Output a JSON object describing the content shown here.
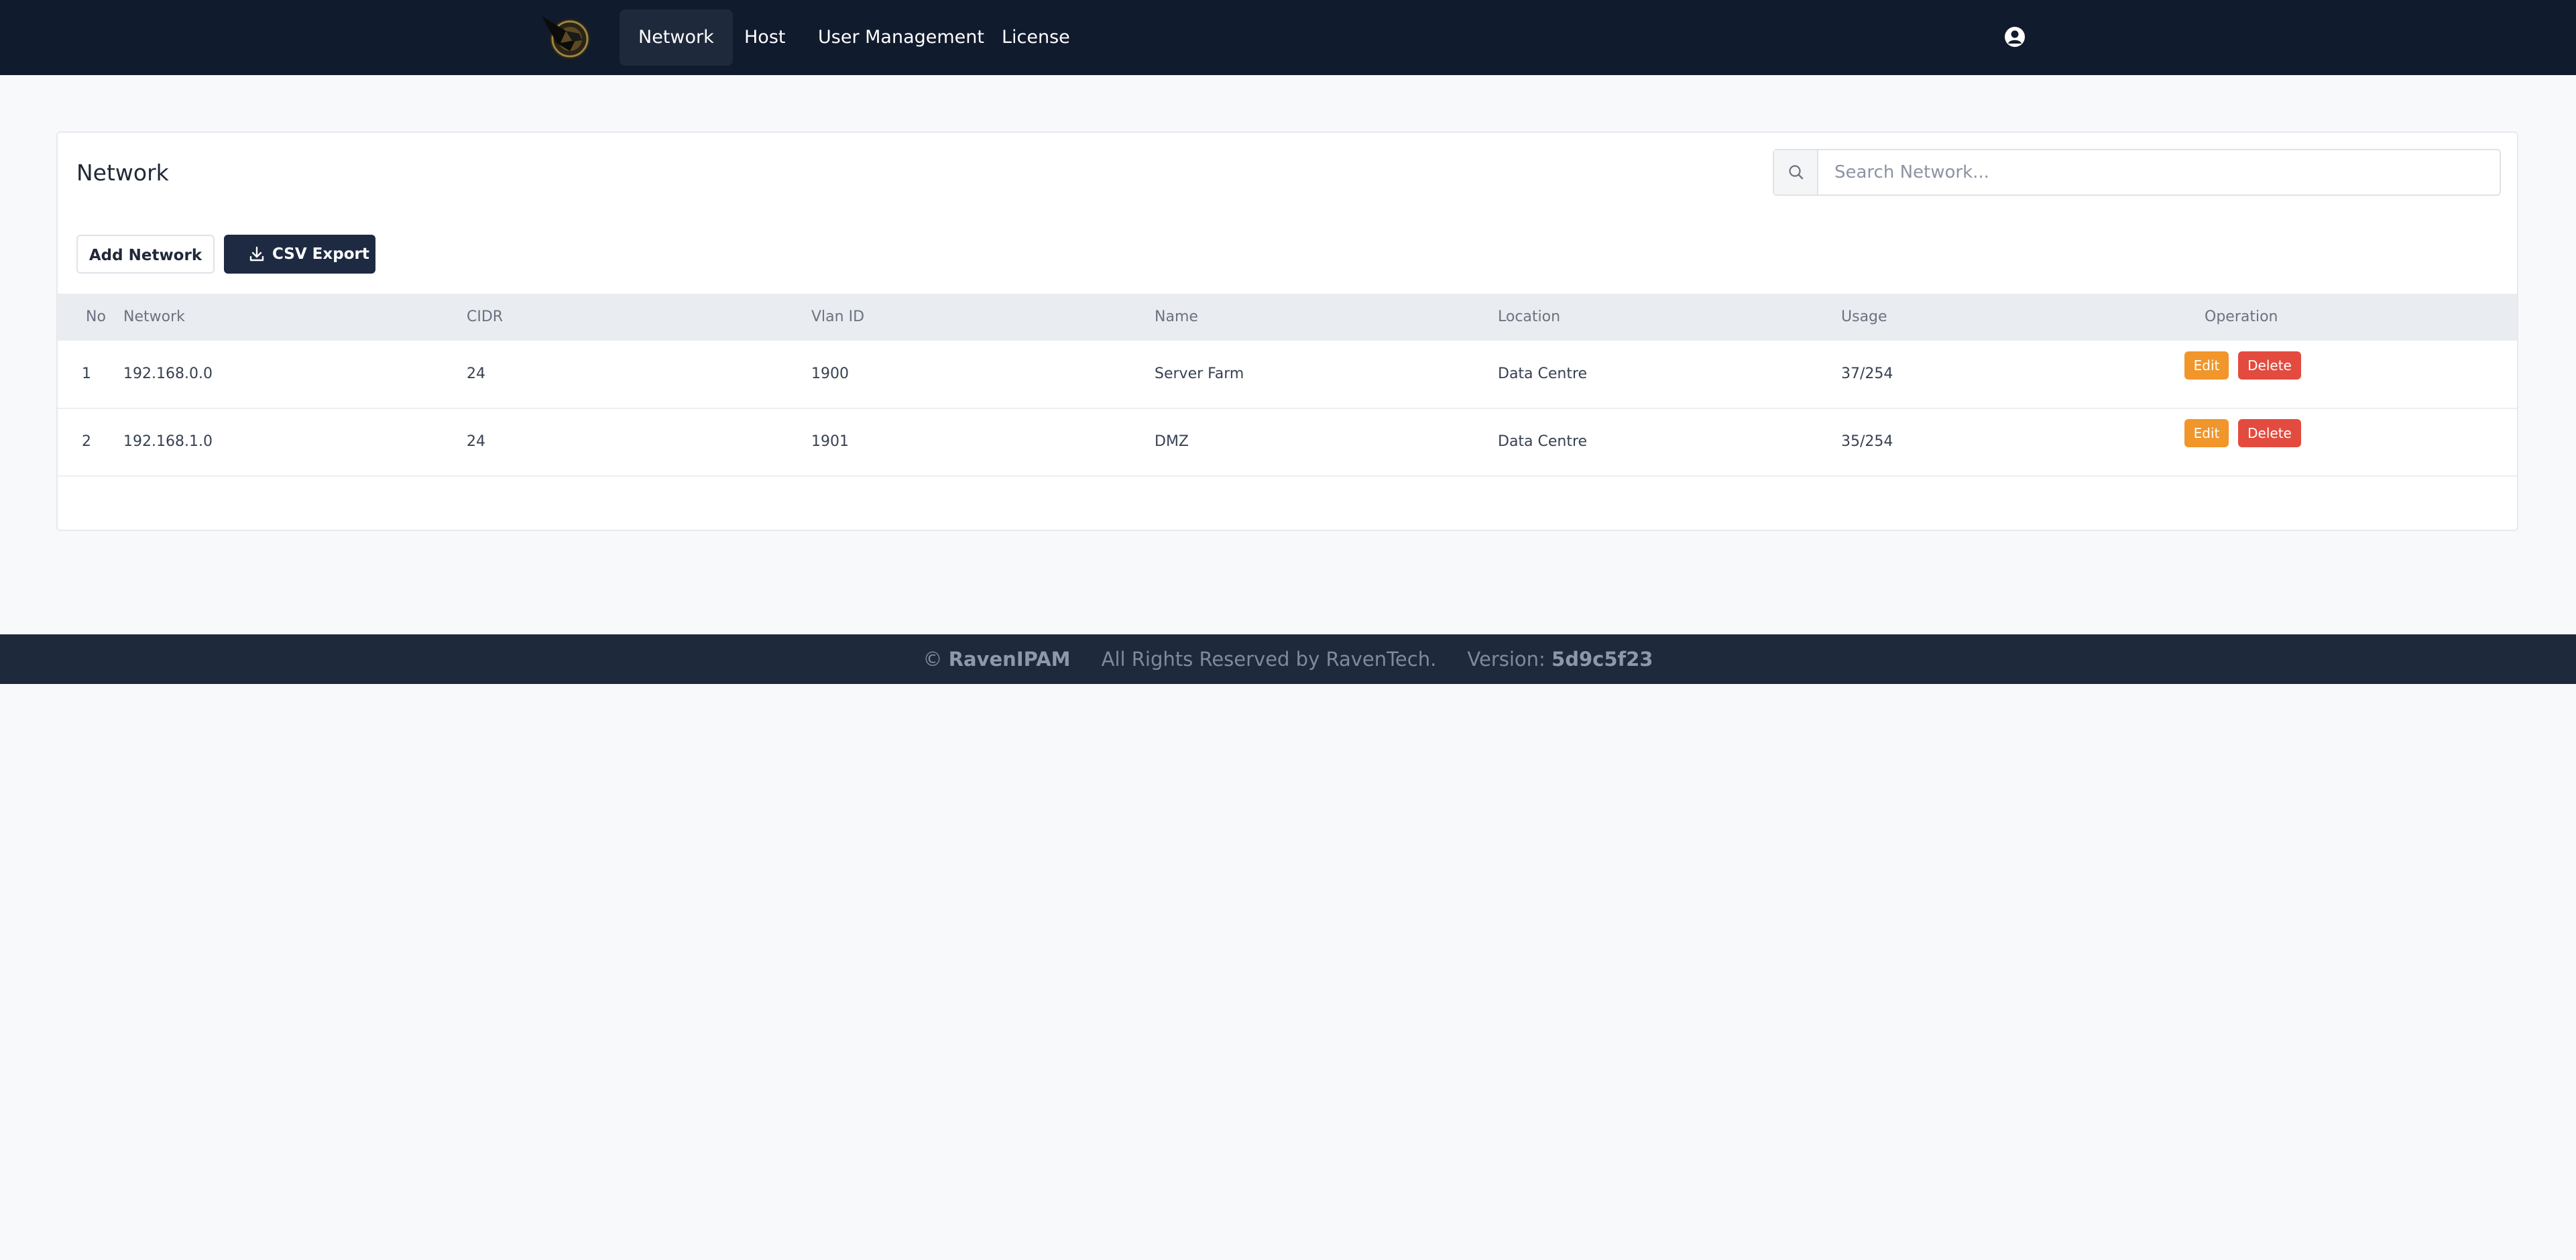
{
  "nav": {
    "items": [
      {
        "label": "Network",
        "active": true
      },
      {
        "label": "Host"
      },
      {
        "label": "User Management"
      },
      {
        "label": "License"
      }
    ],
    "logo_icon": "raven-logo-icon",
    "user_icon": "user-circle-icon"
  },
  "page": {
    "title": "Network",
    "search_placeholder": "Search Network...",
    "add_button": "Add Network",
    "csv_button": "CSV Export"
  },
  "table": {
    "headers": [
      "No",
      "Network",
      "CIDR",
      "Vlan ID",
      "Name",
      "Location",
      "Usage",
      "Operation"
    ],
    "rows": [
      {
        "no": "1",
        "network": "192.168.0.0",
        "cidr": "24",
        "vlan": "1900",
        "name": "Server Farm",
        "location": "Data Centre",
        "usage": "37/254"
      },
      {
        "no": "2",
        "network": "192.168.1.0",
        "cidr": "24",
        "vlan": "1901",
        "name": "DMZ",
        "location": "Data Centre",
        "usage": "35/254"
      }
    ],
    "edit_label": "Edit",
    "delete_label": "Delete"
  },
  "footer": {
    "copyright_symbol": "©",
    "brand": "RavenIPAM",
    "rights": "All Rights Reserved by RavenTech.",
    "version_label": "Version:",
    "version": "5d9c5f23"
  },
  "colors": {
    "nav_bg": "#111b2e",
    "footer_bg": "#1e293b",
    "edit": "#f0962b",
    "delete": "#e34b3f",
    "primary_button": "#1d2a42"
  }
}
